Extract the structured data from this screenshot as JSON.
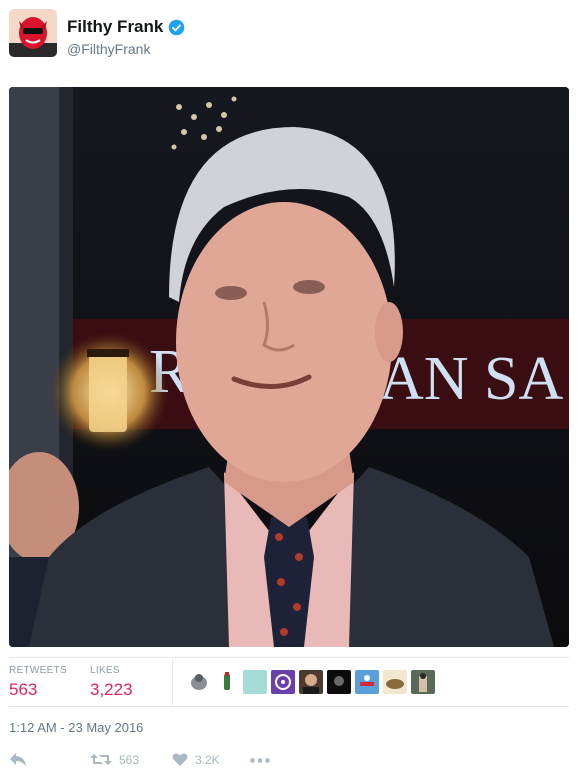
{
  "tweet": {
    "display_name": "Filthy Frank",
    "handle": "@FilthyFrank",
    "verified": true,
    "timestamp": "1:12 AM - 23 May 2016"
  },
  "media": {
    "sign_text": "R AN SA"
  },
  "stats": {
    "retweets_label": "RETWEETS",
    "retweets_value": "563",
    "likes_label": "LIKES",
    "likes_value": "3,223"
  },
  "likers": [
    {
      "icon": "liker-avatar-1"
    },
    {
      "icon": "liker-avatar-2"
    },
    {
      "icon": "liker-avatar-3"
    },
    {
      "icon": "liker-avatar-4"
    },
    {
      "icon": "liker-avatar-5"
    },
    {
      "icon": "liker-avatar-6"
    },
    {
      "icon": "liker-avatar-7"
    },
    {
      "icon": "liker-avatar-8"
    },
    {
      "icon": "liker-avatar-9"
    }
  ],
  "actions": {
    "reply_icon": "reply-icon",
    "retweet_count": "563",
    "like_count": "3.2K",
    "more_icon": "more-icon"
  },
  "colors": {
    "accent_red": "#e0245e",
    "verified_blue": "#1da1f2",
    "muted": "#657786",
    "action_gray": "#aab8c2"
  }
}
